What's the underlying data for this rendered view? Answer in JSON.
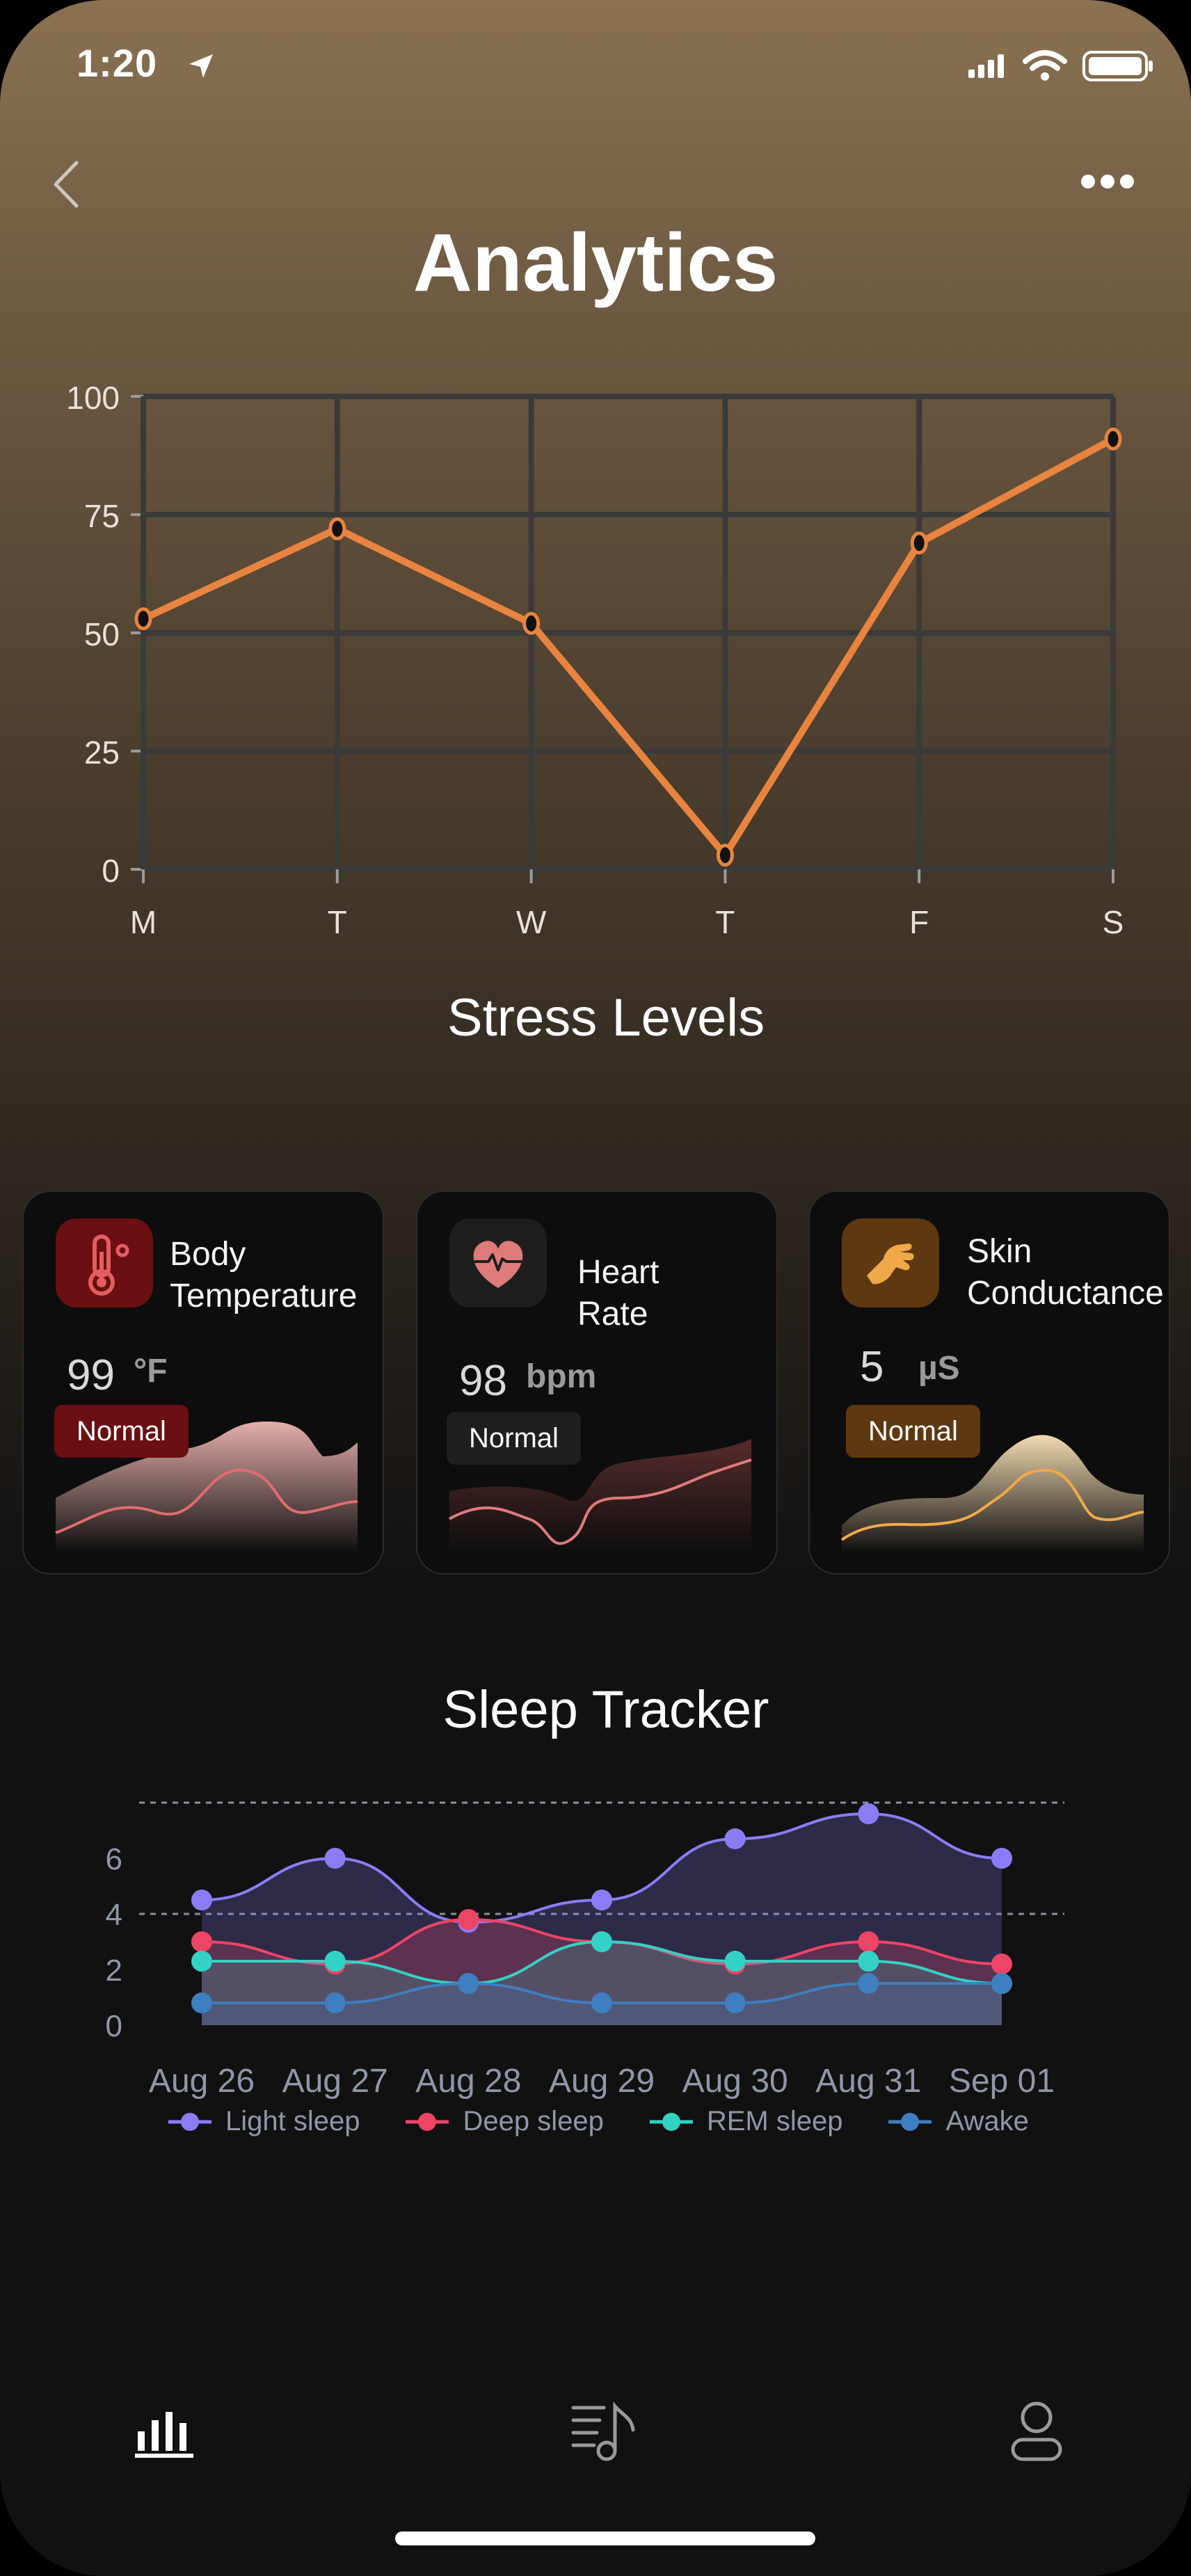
{
  "status_bar": {
    "time": "1:20"
  },
  "header": {
    "title": "Analytics"
  },
  "stress_chart": {
    "subtitle": "Stress Levels",
    "accent": "#e8843f"
  },
  "chart_data": [
    {
      "type": "line",
      "title": "Stress Levels",
      "categories": [
        "M",
        "T",
        "W",
        "T",
        "F",
        "S"
      ],
      "series": [
        {
          "values": [
            53,
            72,
            52,
            3,
            69,
            91
          ]
        }
      ],
      "ylim": [
        0,
        100
      ],
      "yticks": [
        0,
        25,
        50,
        75,
        100
      ],
      "grid": true,
      "color": "#e8843f"
    },
    {
      "type": "area",
      "title": "Sleep Tracker",
      "categories": [
        "Aug 26",
        "Aug 27",
        "Aug 28",
        "Aug 29",
        "Aug 30",
        "Aug 31",
        "Sep 01"
      ],
      "yticks": [
        0,
        2,
        4,
        6
      ],
      "ylim": [
        0,
        8
      ],
      "reference_lines": [
        4,
        8
      ],
      "legend_position": "bottom",
      "series": [
        {
          "name": "Light sleep",
          "color": "#8b7cf6",
          "values": [
            4.5,
            6,
            3.7,
            4.5,
            6.7,
            7.6,
            6
          ]
        },
        {
          "name": "Deep sleep",
          "color": "#ee4466",
          "values": [
            3,
            2.2,
            3.8,
            3,
            2.2,
            3,
            2.2
          ]
        },
        {
          "name": "REM sleep",
          "color": "#34d1c5",
          "values": [
            2.3,
            2.3,
            1.5,
            3,
            2.3,
            2.3,
            1.5
          ]
        },
        {
          "name": "Awake",
          "color": "#3d7fc1",
          "values": [
            0.8,
            0.8,
            1.5,
            0.8,
            0.8,
            1.5,
            1.5
          ]
        }
      ]
    }
  ],
  "cards": [
    {
      "label_line1": "Body",
      "label_line2": "Temperature",
      "value": "99",
      "unit": "°F",
      "status": "Normal",
      "icon": "thermometer-icon",
      "accent": "#e35d63",
      "badge_color": "#6a0f12",
      "icon_bg": "#6a0f12"
    },
    {
      "label_line1": "Heart",
      "label_line2": "Rate",
      "value": "98",
      "unit": "bpm",
      "status": "Normal",
      "icon": "heart-rate-icon",
      "accent": "#e07b7b",
      "badge_color": "#1f1f1f",
      "icon_bg": "#1e1e1e"
    },
    {
      "label_line1": "Skin",
      "label_line2": "Conductance",
      "value": "5",
      "unit": "µS",
      "status": "Normal",
      "icon": "hand-icon",
      "accent": "#f0a94a",
      "badge_color": "#5e3810",
      "icon_bg": "#5e3810"
    }
  ],
  "sleep_tracker": {
    "subtitle": "Sleep Tracker"
  },
  "tab_bar": {
    "items": [
      "analytics-tab",
      "music-tab",
      "profile-tab"
    ]
  }
}
